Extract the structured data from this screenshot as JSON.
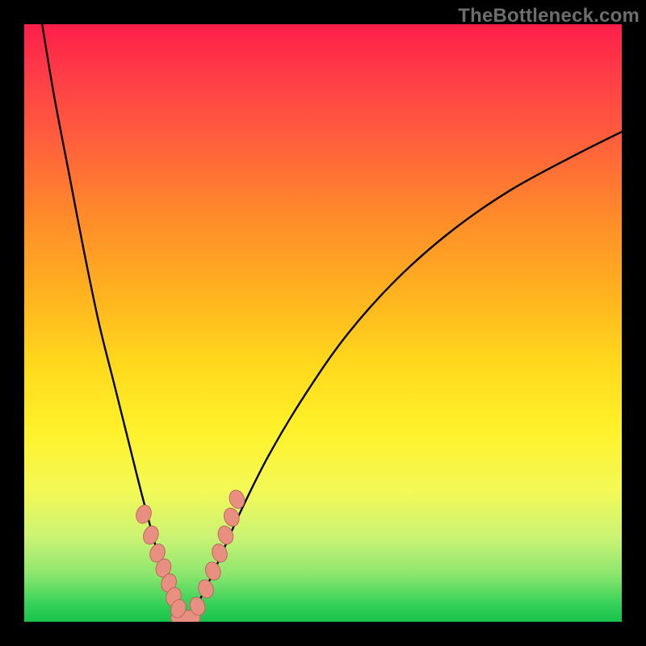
{
  "watermark": "TheBottleneck.com",
  "colors": {
    "black": "#000000",
    "bead_fill": "#e98f82",
    "bead_stroke": "#b96a5d",
    "gradient_top": "#ff1e4a",
    "gradient_bottom": "#18c24a"
  },
  "chart_data": {
    "type": "line",
    "title": "",
    "xlabel": "",
    "ylabel": "",
    "xlim": [
      0,
      100
    ],
    "ylim": [
      0,
      100
    ],
    "note": "Axes unlabeled in source; V-shaped bottleneck curve with minimum near x≈27, y≈0. Values are pixel-derived percentages of plot area (origin bottom-left).",
    "series": [
      {
        "name": "left-branch",
        "x": [
          3.0,
          5.0,
          7.5,
          10.0,
          12.5,
          15.0,
          17.5,
          19.5,
          21.5,
          23.0,
          24.5,
          25.5,
          26.5,
          27.0
        ],
        "y": [
          100.0,
          88.0,
          75.0,
          62.0,
          50.0,
          40.0,
          30.0,
          22.0,
          14.5,
          9.0,
          5.0,
          2.0,
          0.5,
          0.0
        ]
      },
      {
        "name": "right-branch",
        "x": [
          27.0,
          29.0,
          32.0,
          36.0,
          41.0,
          47.0,
          54.0,
          62.0,
          71.0,
          81.0,
          92.0,
          100.0
        ],
        "y": [
          0.0,
          3.0,
          9.0,
          18.0,
          28.0,
          38.0,
          48.0,
          57.0,
          65.0,
          72.0,
          78.0,
          82.0
        ]
      }
    ],
    "markers": {
      "name": "beads",
      "note": "Salmon-colored elliptical markers along lower part of V; pill-shaped cluster at trough.",
      "x": [
        20.0,
        21.2,
        22.3,
        23.3,
        24.2,
        25.0,
        25.8,
        27.0,
        29.0,
        30.4,
        31.6,
        32.7,
        33.7,
        34.7,
        35.6
      ],
      "y": [
        18.0,
        14.5,
        11.5,
        9.0,
        6.5,
        4.2,
        2.2,
        0.0,
        2.6,
        5.5,
        8.5,
        11.5,
        14.5,
        17.5,
        20.5
      ]
    }
  }
}
